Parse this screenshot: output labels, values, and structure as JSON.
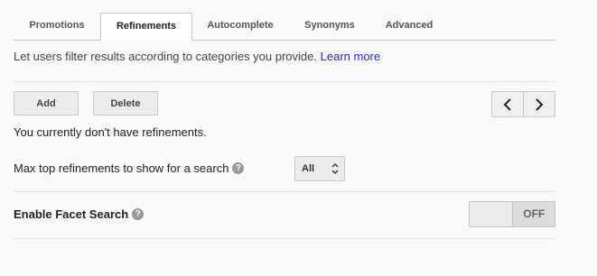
{
  "tabs": [
    {
      "label": "Promotions",
      "active": false
    },
    {
      "label": "Refinements",
      "active": true
    },
    {
      "label": "Autocomplete",
      "active": false
    },
    {
      "label": "Synonyms",
      "active": false
    },
    {
      "label": "Advanced",
      "active": false
    }
  ],
  "description": {
    "text": "Let users filter results according to categories you provide.",
    "link_label": "Learn more"
  },
  "toolbar": {
    "add_label": "Add",
    "delete_label": "Delete",
    "prev_icon": "chevron-left-icon",
    "next_icon": "chevron-right-icon"
  },
  "empty_message": "You currently don't have refinements.",
  "max_refinements": {
    "label": "Max top refinements to show for a search",
    "help_icon": "help-icon",
    "selected": "All"
  },
  "facet_search": {
    "label": "Enable Facet Search",
    "help_icon": "help-icon",
    "state_label": "OFF"
  },
  "colors": {
    "link": "#2a2ab4",
    "background": "#fafafa",
    "border": "#c6c6c6"
  }
}
